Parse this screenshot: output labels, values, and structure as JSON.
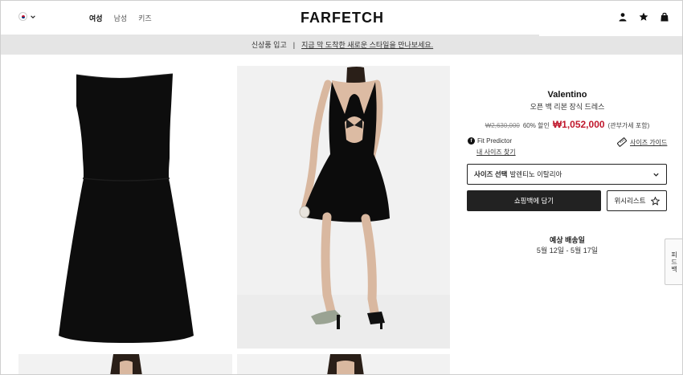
{
  "header": {
    "locale_icon": "korea-flag-icon",
    "nav": [
      "여성",
      "남성",
      "키즈"
    ],
    "logo": "FARFETCH",
    "icons": [
      "account-icon",
      "star-icon",
      "bag-icon"
    ]
  },
  "promo": {
    "left": "신상품 입고",
    "divider": "|",
    "link": "지금 막 도착한 새로운 스타일을 만나보세요."
  },
  "product": {
    "brand": "Valentino",
    "name": "오픈 백 리본 장식 드레스",
    "original_price": "₩2,630,000",
    "discount": "60% 할인",
    "sale_price": "₩1,052,000",
    "tax_note": "(관부가세 포함)",
    "fit_predictor": "Fit Predictor",
    "find_size": "내 사이즈 찾기",
    "size_guide": "사이즈 가이드",
    "size_select_label": "사이즈 선택",
    "size_select_value": "발렌티노 이탈리아",
    "add_to_bag": "쇼핑백에 담기",
    "wishlist": "위시리스트",
    "shipping_title": "예상 배송일",
    "shipping_date": "5월 12일 - 5월 17일"
  },
  "feedback_tab": "피드백",
  "colors": {
    "sale": "#c0182d",
    "button_dark": "#222222",
    "promo_bg": "#e5e5e5"
  }
}
